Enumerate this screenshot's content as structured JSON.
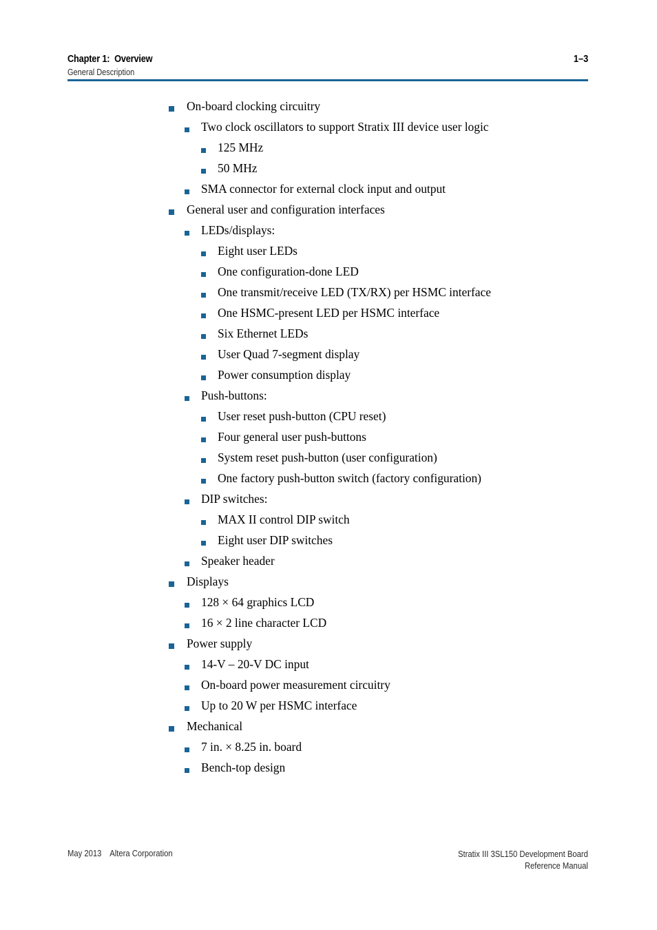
{
  "header": {
    "chapter": "Chapter 1:  Overview",
    "section": "General Description",
    "page_number": "1–3",
    "rule_color": "#1a6496"
  },
  "bullet_color": "#1a6496",
  "content": {
    "items": [
      {
        "level": 1,
        "text": "On-board clocking circuitry"
      },
      {
        "level": 2,
        "text": "Two clock oscillators to support Stratix III device user logic"
      },
      {
        "level": 3,
        "text": "125 MHz"
      },
      {
        "level": 3,
        "text": "50 MHz"
      },
      {
        "level": 2,
        "text": "SMA connector for external clock input and output"
      },
      {
        "level": 1,
        "text": "General user and configuration interfaces"
      },
      {
        "level": 2,
        "text": "LEDs/displays:"
      },
      {
        "level": 3,
        "text": "Eight user LEDs"
      },
      {
        "level": 3,
        "text": "One configuration-done LED"
      },
      {
        "level": 3,
        "text": "One transmit/receive LED (TX/RX) per HSMC interface"
      },
      {
        "level": 3,
        "text": "One HSMC-present LED per HSMC interface"
      },
      {
        "level": 3,
        "text": "Six Ethernet LEDs"
      },
      {
        "level": 3,
        "text": "User Quad 7-segment display"
      },
      {
        "level": 3,
        "text": "Power consumption display"
      },
      {
        "level": 2,
        "text": "Push-buttons:"
      },
      {
        "level": 3,
        "text": "User reset push-button (CPU reset)"
      },
      {
        "level": 3,
        "text": "Four general user push-buttons"
      },
      {
        "level": 3,
        "text": "System reset push-button (user configuration)"
      },
      {
        "level": 3,
        "text": "One factory push-button switch (factory configuration)"
      },
      {
        "level": 2,
        "text": "DIP switches:"
      },
      {
        "level": 3,
        "text": "MAX II control DIP switch"
      },
      {
        "level": 3,
        "text": "Eight user DIP switches"
      },
      {
        "level": 2,
        "text": "Speaker header"
      },
      {
        "level": 1,
        "text": "Displays"
      },
      {
        "level": 2,
        "text": "128 × 64 graphics LCD"
      },
      {
        "level": 2,
        "text": "16 × 2 line character LCD"
      },
      {
        "level": 1,
        "text": "Power supply"
      },
      {
        "level": 2,
        "text": "14-V – 20-V DC input"
      },
      {
        "level": 2,
        "text": "On-board power measurement circuitry"
      },
      {
        "level": 2,
        "text": "Up to 20 W per HSMC interface"
      },
      {
        "level": 1,
        "text": "Mechanical"
      },
      {
        "level": 2,
        "text": "7 in. × 8.25 in. board"
      },
      {
        "level": 2,
        "text": "Bench-top design"
      }
    ]
  },
  "footer": {
    "left": "May 2013    Altera Corporation",
    "right_line1": "Stratix III 3SL150 Development Board",
    "right_line2": "Reference Manual"
  }
}
